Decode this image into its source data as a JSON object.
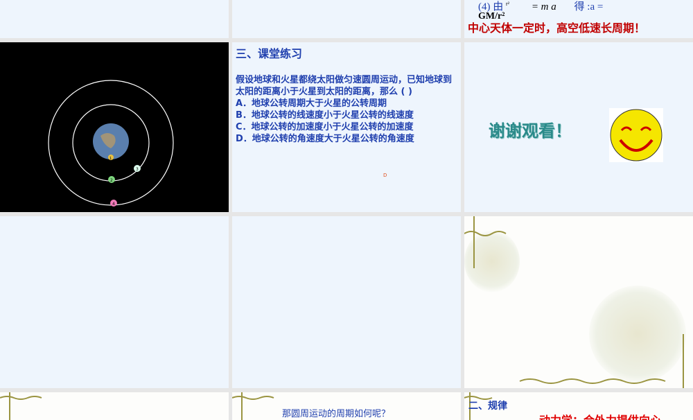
{
  "slide_top_right": {
    "formula_prefix": "(4) 由",
    "frac_den": "r²",
    "formula_mid": "= m a",
    "formula_de": "得 :a =",
    "formula_result": "GM/r²",
    "conclusion": "中心天体一定时，高空低速长周期！"
  },
  "practice": {
    "title": "三、课堂练习",
    "question": "假设地球和火星都绕太阳做匀速圆周运动，已知地球到太阳的距离小于火星到太阳的距离，那么 (    )",
    "options": [
      "A．地球公转周期大于火星的公转周期",
      "B．地球公转的线速度小于火星公转的线速度",
      "C．地球公转的加速度小于火星公转的加速度",
      "D．地球公转的角速度大于火星公转的角速度"
    ],
    "answer": "D"
  },
  "orbit": {
    "labels": [
      "1",
      "2",
      "3",
      "4"
    ]
  },
  "thanks": {
    "text": "谢谢观看！"
  },
  "bottom": {
    "question": "那圆周运动的周期如何呢？",
    "heading": "二、规律",
    "red_text": "动力学：合外力提供向心"
  },
  "colors": {
    "blue": "#1f3fae",
    "red": "#c00000",
    "bg": "#eef5fd"
  }
}
